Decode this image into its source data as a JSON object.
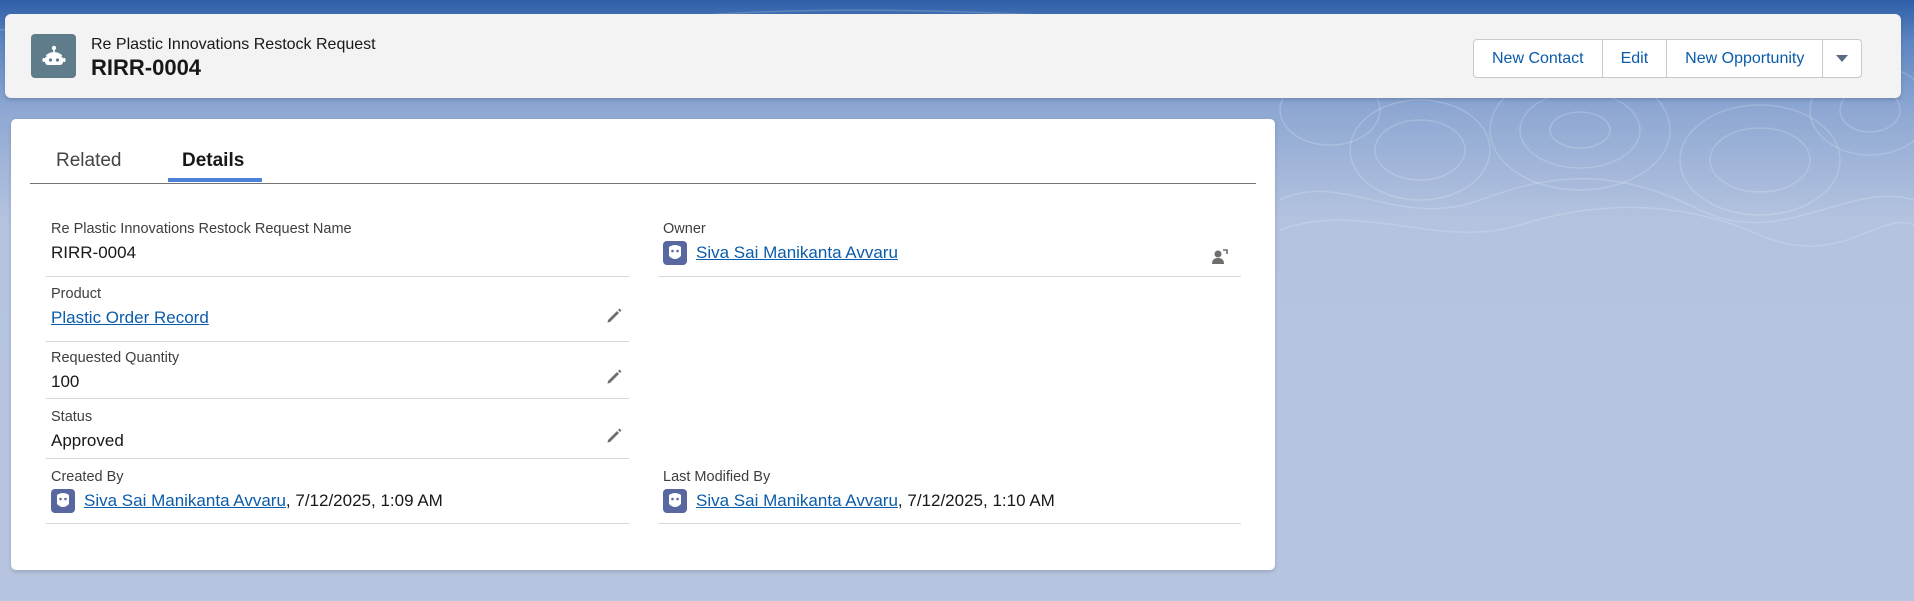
{
  "header": {
    "object_label": "Re Plastic Innovations Restock Request",
    "record_name": "RIRR-0004",
    "icon": "robot-icon",
    "actions": [
      "New Contact",
      "Edit",
      "New Opportunity"
    ],
    "menu_icon": "chevron-down-icon"
  },
  "tabs": {
    "related": "Related",
    "details": "Details",
    "active": "Details"
  },
  "fields": {
    "name": {
      "label": "Re Plastic Innovations Restock Request Name",
      "value": "RIRR-0004"
    },
    "owner": {
      "label": "Owner",
      "value": "Siva Sai Manikanta Avvaru",
      "action_icon": "change-owner-icon"
    },
    "product": {
      "label": "Product",
      "value": "Plastic Order Record"
    },
    "quantity": {
      "label": "Requested Quantity",
      "value": "100"
    },
    "status": {
      "label": "Status",
      "value": "Approved"
    },
    "created_by": {
      "label": "Created By",
      "user": "Siva Sai Manikanta Avvaru",
      "timestamp": ", 7/12/2025, 1:09 AM"
    },
    "modified_by": {
      "label": "Last Modified By",
      "user": "Siva Sai Manikanta Avvaru",
      "timestamp": ", 7/12/2025, 1:10 AM"
    }
  },
  "colors": {
    "link": "#0b5cab",
    "record_icon": "#5e7c8a",
    "user_icon": "#5867a0",
    "active_tab": "#4d81d6"
  }
}
